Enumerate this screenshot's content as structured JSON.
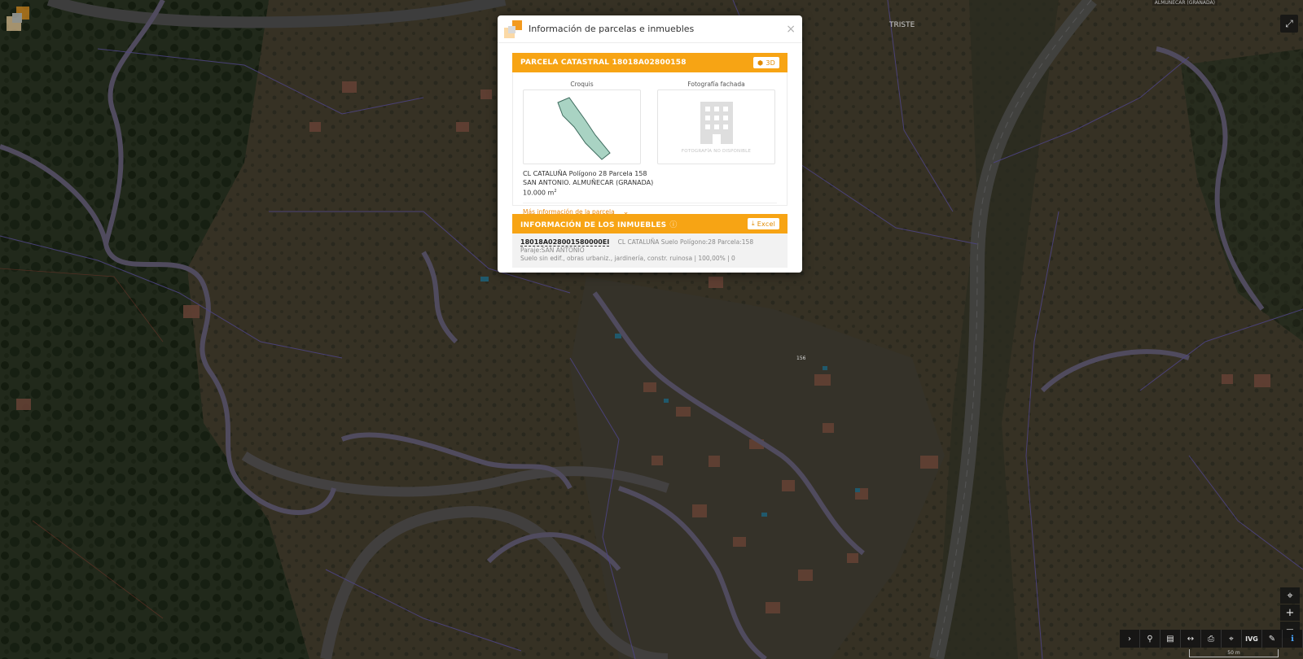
{
  "map": {
    "location_tag": "ALMUÑÉCAR (GRANADA)",
    "street_label": "TRISTE",
    "scale_label": "50 m",
    "parcel_number_1": "156",
    "parcel_number_2": "158"
  },
  "dialog": {
    "title": "Información de parcelas e inmuebles",
    "close_symbol": "×",
    "parcel": {
      "header": "PARCELA CATASTRAL 18018A02800158",
      "btn_3d": "3D",
      "sketch_label": "Croquis",
      "photo_label": "Fotografía fachada",
      "photo_unavailable": "FOTOGRAFÍA NO DISPONIBLE",
      "address_line1": "CL CATALUÑA Polígono 28 Parcela 158",
      "address_line2": "SAN ANTONIO. ALMUÑECAR (GRANADA)",
      "area": "10.000 m",
      "area_sup": "2",
      "more_info": "Más información de la parcela"
    },
    "properties": {
      "header": "INFORMACIÓN DE LOS INMUEBLES",
      "excel_label": "Excel",
      "rows": [
        {
          "ref": "18018A028001580000EI",
          "desc": "CL CATALUÑA Suelo Polígono:28 Parcela:158",
          "line2": "Paraje:SAN ANTONIO",
          "line3": "Suelo sin edif., obras urbaniz., jardinería, constr. ruinosa  |  100,00%  |  0"
        }
      ]
    }
  },
  "toolbar": {
    "ivg_label": "IVG"
  },
  "colors": {
    "accent": "#f7a414",
    "link": "#e8870c",
    "parcel_fill": "#a9d3c3",
    "boundary": "#7b6cc8"
  }
}
